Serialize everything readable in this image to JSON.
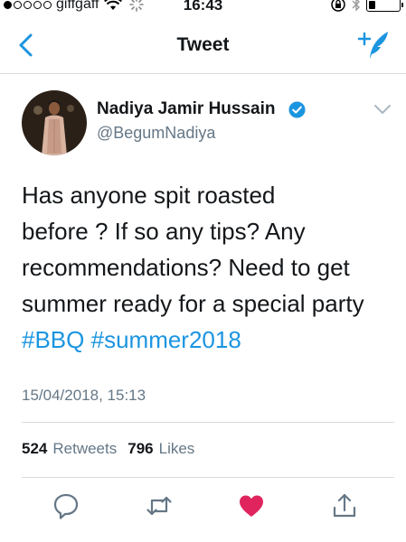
{
  "status_bar": {
    "carrier": "giffgaff",
    "time": "16:43",
    "battery_level": 0.3
  },
  "nav": {
    "title": "Tweet",
    "back_icon": "chevron-left-icon",
    "compose_icon": "compose-tweet-icon"
  },
  "tweet": {
    "author_name": "Nadiya Jamir Hussain",
    "author_handle": "@BegumNadiya",
    "verified": true,
    "text_lines": [
      "Has anyone spit roasted",
      "before ? If so any tips? Any",
      "recommendations? Need to get",
      "summer ready for a special party"
    ],
    "hashtag_1": "#BBQ",
    "hashtag_2": "#summer2018",
    "date": "15/04/2018, 15:13"
  },
  "stats": {
    "retweets_count": "524",
    "retweets_label": "Retweets",
    "likes_count": "796",
    "likes_label": "Likes"
  },
  "colors": {
    "accent": "#1b95e0",
    "liked": "#e0245e",
    "secondary_text": "#657786",
    "divider": "#dadada"
  },
  "actions": {
    "reply_icon": "reply-icon",
    "retweet_icon": "retweet-icon",
    "like_icon": "heart-icon",
    "share_icon": "share-icon"
  }
}
